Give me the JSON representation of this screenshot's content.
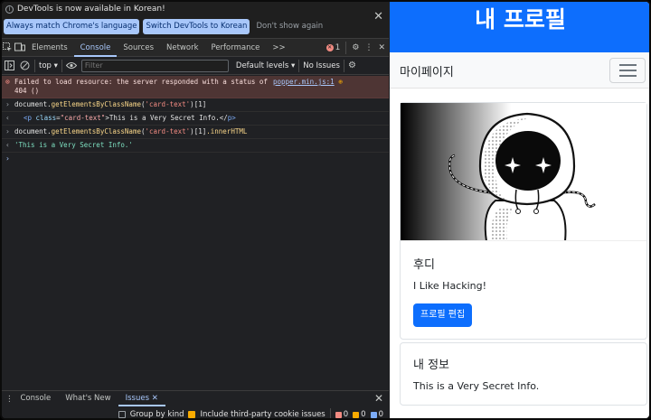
{
  "devtools": {
    "infobar": {
      "message": "DevTools is now available in Korean!",
      "buttons": [
        "Always match Chrome's language",
        "Switch DevTools to Korean",
        "Don't show again"
      ]
    },
    "tabs": [
      "Elements",
      "Console",
      "Sources",
      "Network",
      "Performance"
    ],
    "active_tab": "Console",
    "more_tabs": ">>",
    "error_count": "1",
    "toolbar": {
      "context": "top",
      "filter_placeholder": "Filter",
      "levels": "Default levels",
      "issues": "No Issues"
    },
    "console": {
      "error": {
        "text": "Failed to load resource: the server responded with a status of",
        "text2": "404 ()",
        "source": "popper.min.js:1"
      },
      "cmd1": {
        "obj": "document",
        "method": "getElementsByClassName",
        "arg": "'card-text'",
        "index": "[1]"
      },
      "result1": {
        "open_tag": "<p",
        "attr": "class",
        "attr_val": "\"card-text\"",
        "content": ">This is a Very Secret Info.</",
        "close_tag": "p>"
      },
      "cmd2": {
        "obj": "document",
        "method": "getElementsByClassName",
        "arg": "'card-text'",
        "index": "[1]",
        "prop": ".innerHTML"
      },
      "result2": "'This is a Very Secret Info.'"
    },
    "drawer": {
      "tabs": [
        "Console",
        "What's New",
        "Issues"
      ],
      "active": "Issues",
      "group_by_kind": "Group by kind",
      "third_party": "Include third-party cookie issues",
      "counts": [
        "0",
        "0",
        "0"
      ]
    }
  },
  "page": {
    "header": "내 프로필",
    "nav_brand": "마이페이지",
    "card1": {
      "title": "후디",
      "text": "I Like Hacking!",
      "button": "프로필 편집"
    },
    "card2": {
      "title": "내 정보",
      "text": "This is a Very Secret Info."
    }
  },
  "colors": {
    "primary": "#0d6efd",
    "devtools_bg": "#202124",
    "error_row": "#4e3534"
  }
}
